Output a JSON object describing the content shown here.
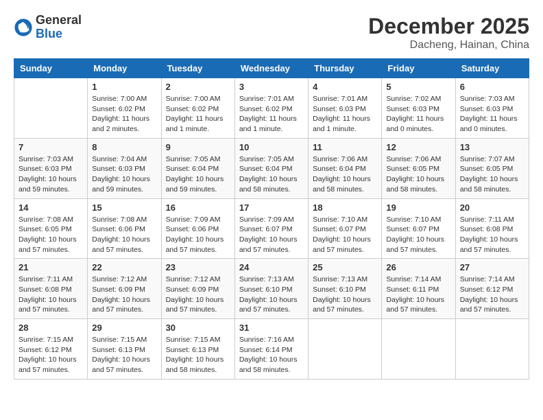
{
  "header": {
    "logo_general": "General",
    "logo_blue": "Blue",
    "month_title": "December 2025",
    "location": "Dacheng, Hainan, China"
  },
  "days_of_week": [
    "Sunday",
    "Monday",
    "Tuesday",
    "Wednesday",
    "Thursday",
    "Friday",
    "Saturday"
  ],
  "weeks": [
    [
      {
        "day": "",
        "info": ""
      },
      {
        "day": "1",
        "info": "Sunrise: 7:00 AM\nSunset: 6:02 PM\nDaylight: 11 hours\nand 2 minutes."
      },
      {
        "day": "2",
        "info": "Sunrise: 7:00 AM\nSunset: 6:02 PM\nDaylight: 11 hours\nand 1 minute."
      },
      {
        "day": "3",
        "info": "Sunrise: 7:01 AM\nSunset: 6:02 PM\nDaylight: 11 hours\nand 1 minute."
      },
      {
        "day": "4",
        "info": "Sunrise: 7:01 AM\nSunset: 6:03 PM\nDaylight: 11 hours\nand 1 minute."
      },
      {
        "day": "5",
        "info": "Sunrise: 7:02 AM\nSunset: 6:03 PM\nDaylight: 11 hours\nand 0 minutes."
      },
      {
        "day": "6",
        "info": "Sunrise: 7:03 AM\nSunset: 6:03 PM\nDaylight: 11 hours\nand 0 minutes."
      }
    ],
    [
      {
        "day": "7",
        "info": "Sunrise: 7:03 AM\nSunset: 6:03 PM\nDaylight: 10 hours\nand 59 minutes."
      },
      {
        "day": "8",
        "info": "Sunrise: 7:04 AM\nSunset: 6:03 PM\nDaylight: 10 hours\nand 59 minutes."
      },
      {
        "day": "9",
        "info": "Sunrise: 7:05 AM\nSunset: 6:04 PM\nDaylight: 10 hours\nand 59 minutes."
      },
      {
        "day": "10",
        "info": "Sunrise: 7:05 AM\nSunset: 6:04 PM\nDaylight: 10 hours\nand 58 minutes."
      },
      {
        "day": "11",
        "info": "Sunrise: 7:06 AM\nSunset: 6:04 PM\nDaylight: 10 hours\nand 58 minutes."
      },
      {
        "day": "12",
        "info": "Sunrise: 7:06 AM\nSunset: 6:05 PM\nDaylight: 10 hours\nand 58 minutes."
      },
      {
        "day": "13",
        "info": "Sunrise: 7:07 AM\nSunset: 6:05 PM\nDaylight: 10 hours\nand 58 minutes."
      }
    ],
    [
      {
        "day": "14",
        "info": "Sunrise: 7:08 AM\nSunset: 6:05 PM\nDaylight: 10 hours\nand 57 minutes."
      },
      {
        "day": "15",
        "info": "Sunrise: 7:08 AM\nSunset: 6:06 PM\nDaylight: 10 hours\nand 57 minutes."
      },
      {
        "day": "16",
        "info": "Sunrise: 7:09 AM\nSunset: 6:06 PM\nDaylight: 10 hours\nand 57 minutes."
      },
      {
        "day": "17",
        "info": "Sunrise: 7:09 AM\nSunset: 6:07 PM\nDaylight: 10 hours\nand 57 minutes."
      },
      {
        "day": "18",
        "info": "Sunrise: 7:10 AM\nSunset: 6:07 PM\nDaylight: 10 hours\nand 57 minutes."
      },
      {
        "day": "19",
        "info": "Sunrise: 7:10 AM\nSunset: 6:07 PM\nDaylight: 10 hours\nand 57 minutes."
      },
      {
        "day": "20",
        "info": "Sunrise: 7:11 AM\nSunset: 6:08 PM\nDaylight: 10 hours\nand 57 minutes."
      }
    ],
    [
      {
        "day": "21",
        "info": "Sunrise: 7:11 AM\nSunset: 6:08 PM\nDaylight: 10 hours\nand 57 minutes."
      },
      {
        "day": "22",
        "info": "Sunrise: 7:12 AM\nSunset: 6:09 PM\nDaylight: 10 hours\nand 57 minutes."
      },
      {
        "day": "23",
        "info": "Sunrise: 7:12 AM\nSunset: 6:09 PM\nDaylight: 10 hours\nand 57 minutes."
      },
      {
        "day": "24",
        "info": "Sunrise: 7:13 AM\nSunset: 6:10 PM\nDaylight: 10 hours\nand 57 minutes."
      },
      {
        "day": "25",
        "info": "Sunrise: 7:13 AM\nSunset: 6:10 PM\nDaylight: 10 hours\nand 57 minutes."
      },
      {
        "day": "26",
        "info": "Sunrise: 7:14 AM\nSunset: 6:11 PM\nDaylight: 10 hours\nand 57 minutes."
      },
      {
        "day": "27",
        "info": "Sunrise: 7:14 AM\nSunset: 6:12 PM\nDaylight: 10 hours\nand 57 minutes."
      }
    ],
    [
      {
        "day": "28",
        "info": "Sunrise: 7:15 AM\nSunset: 6:12 PM\nDaylight: 10 hours\nand 57 minutes."
      },
      {
        "day": "29",
        "info": "Sunrise: 7:15 AM\nSunset: 6:13 PM\nDaylight: 10 hours\nand 57 minutes."
      },
      {
        "day": "30",
        "info": "Sunrise: 7:15 AM\nSunset: 6:13 PM\nDaylight: 10 hours\nand 58 minutes."
      },
      {
        "day": "31",
        "info": "Sunrise: 7:16 AM\nSunset: 6:14 PM\nDaylight: 10 hours\nand 58 minutes."
      },
      {
        "day": "",
        "info": ""
      },
      {
        "day": "",
        "info": ""
      },
      {
        "day": "",
        "info": ""
      }
    ]
  ]
}
